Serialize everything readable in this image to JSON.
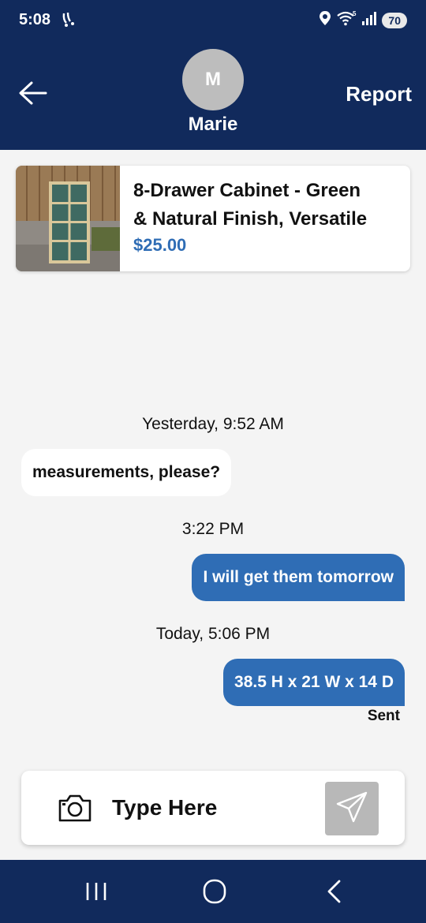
{
  "status_bar": {
    "time": "5:08",
    "battery": "70",
    "network_badge": "5"
  },
  "header": {
    "avatar_initial": "M",
    "contact_name": "Marie",
    "report_label": "Report"
  },
  "listing": {
    "title_line1": "8-Drawer Cabinet - Green",
    "title_line2": "& Natural Finish, Versatile",
    "price": "$25.00"
  },
  "conversation": [
    {
      "type": "timestamp",
      "text": "Yesterday, 9:52 AM"
    },
    {
      "type": "incoming",
      "text": "measurements, please?"
    },
    {
      "type": "timestamp",
      "text": "3:22 PM"
    },
    {
      "type": "outgoing",
      "text": "I will get them tomorrow"
    },
    {
      "type": "timestamp",
      "text": "Today, 5:06 PM"
    },
    {
      "type": "outgoing",
      "text": "38.5 H x 21 W x 14 D"
    }
  ],
  "sent_status": "Sent",
  "compose": {
    "placeholder": "Type Here"
  },
  "icons": {
    "back": "back-arrow-icon",
    "camera": "camera-icon",
    "send": "send-icon",
    "nav_recents": "recents-icon",
    "nav_home": "home-icon",
    "nav_back": "nav-back-icon"
  },
  "colors": {
    "brand_navy": "#112a5c",
    "accent_blue": "#2f6db5",
    "send_disabled": "#b8b8b8"
  }
}
